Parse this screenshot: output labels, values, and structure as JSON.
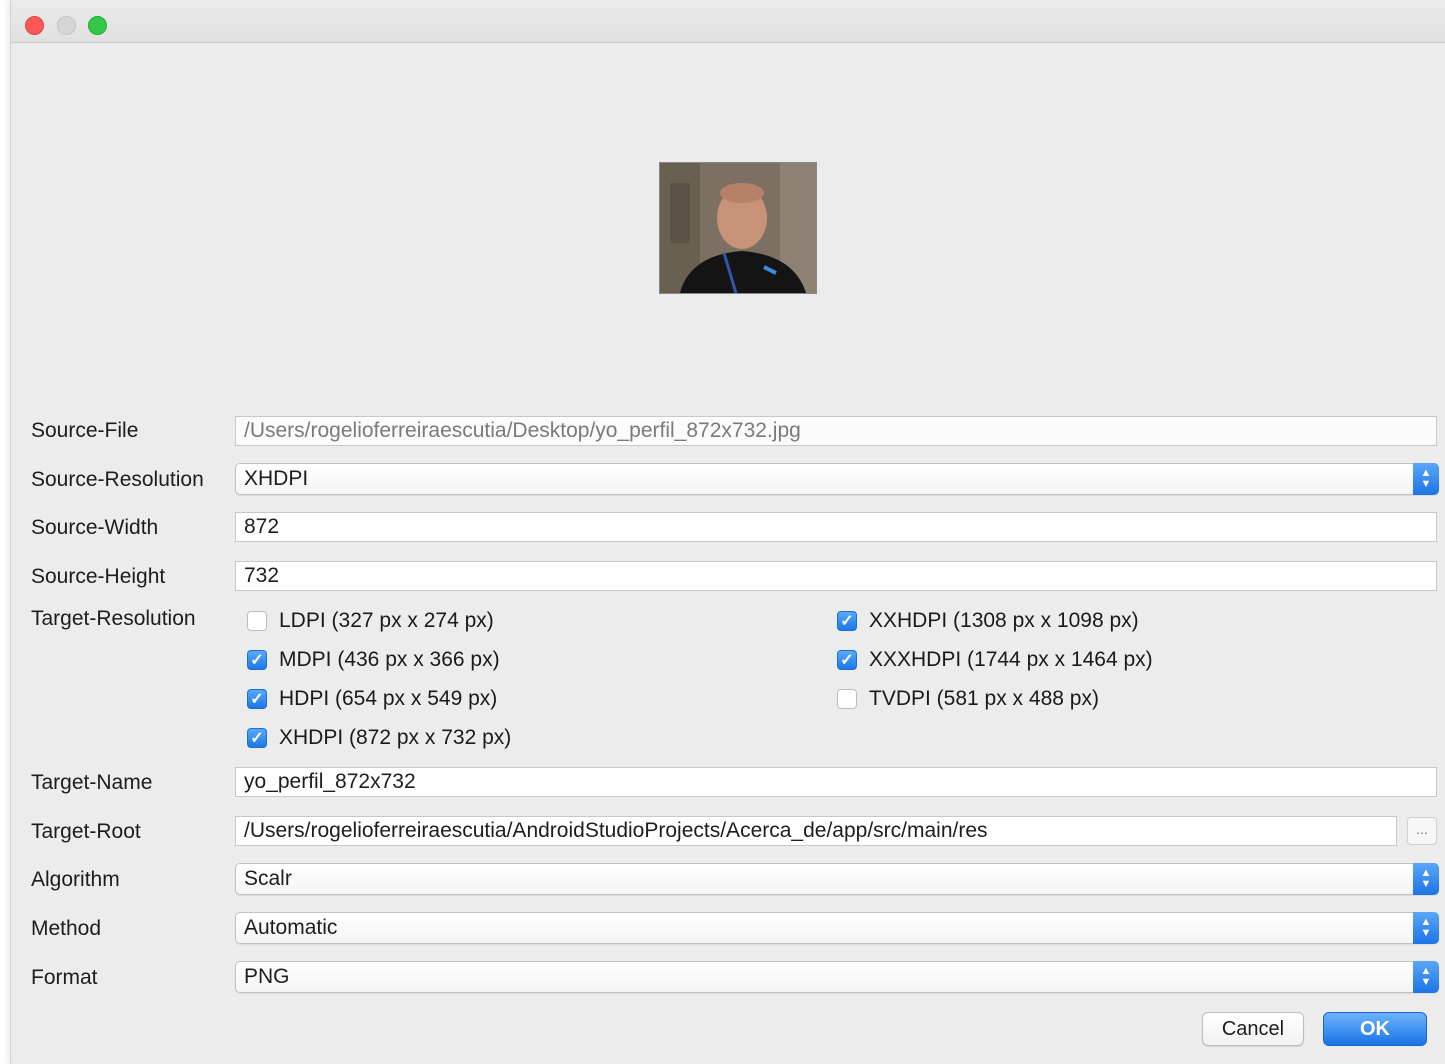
{
  "window": {
    "controls": [
      "close",
      "minimize",
      "maximize"
    ]
  },
  "preview": {
    "description_icon": "profile-photo"
  },
  "form": {
    "source_file": {
      "label": "Source-File",
      "value": "/Users/rogelioferreiraescutia/Desktop/yo_perfil_872x732.jpg"
    },
    "source_resolution": {
      "label": "Source-Resolution",
      "value": "XHDPI"
    },
    "source_width": {
      "label": "Source-Width",
      "value": "872"
    },
    "source_height": {
      "label": "Source-Height",
      "value": "732"
    },
    "target_resolution": {
      "label": "Target-Resolution",
      "options": [
        {
          "label": "LDPI (327 px x 274 px)",
          "checked": false
        },
        {
          "label": "MDPI (436 px x 366 px)",
          "checked": true
        },
        {
          "label": "HDPI (654 px x 549 px)",
          "checked": true
        },
        {
          "label": "XHDPI (872 px x 732 px)",
          "checked": true
        },
        {
          "label": "XXHDPI (1308 px x 1098 px)",
          "checked": true
        },
        {
          "label": "XXXHDPI (1744 px x 1464 px)",
          "checked": true
        },
        {
          "label": "TVDPI (581 px x 488 px)",
          "checked": false
        }
      ]
    },
    "target_name": {
      "label": "Target-Name",
      "value": "yo_perfil_872x732"
    },
    "target_root": {
      "label": "Target-Root",
      "value": "/Users/rogelioferreiraescutia/AndroidStudioProjects/Acerca_de/app/src/main/res",
      "browse_label": "..."
    },
    "algorithm": {
      "label": "Algorithm",
      "value": "Scalr"
    },
    "method": {
      "label": "Method",
      "value": "Automatic"
    },
    "format": {
      "label": "Format",
      "value": "PNG"
    }
  },
  "buttons": {
    "cancel": "Cancel",
    "ok": "OK"
  },
  "colors": {
    "accent": "#1a73e8",
    "close": "#fc5753",
    "maximize": "#33c748"
  }
}
